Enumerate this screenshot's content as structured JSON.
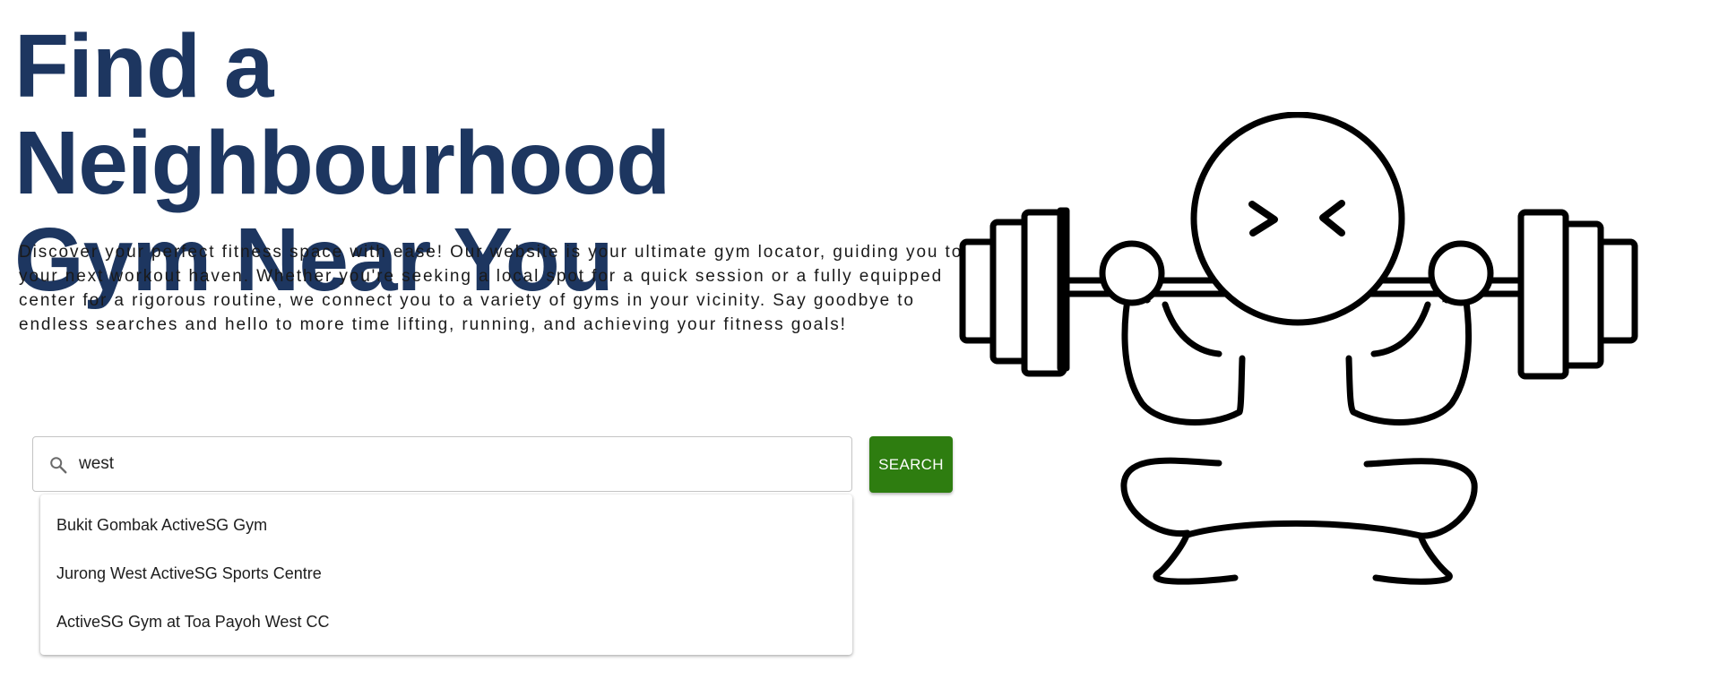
{
  "hero": {
    "title_line1": "Find a Neighbourhood",
    "title_line2": "Gym Near You",
    "description": "Discover your perfect fitness space with ease! Our website is your ultimate gym locator, guiding you to your next workout haven. Whether you're seeking a local spot for a quick session or a fully equipped center for a rigorous routine, we connect you to a variety of gyms in your vicinity. Say goodbye to endless searches and hello to more time lifting, running, and achieving your fitness goals!"
  },
  "search": {
    "icon": "search-icon",
    "value": "west",
    "button_label": "SEARCH"
  },
  "suggestions": [
    "Bukit Gombak ActiveSG Gym",
    "Jurong West ActiveSG Sports Centre",
    "ActiveSG Gym at Toa Payoh West CC"
  ],
  "illustration": {
    "icon": "weightlifter-illustration"
  },
  "colors": {
    "title": "#1d3660",
    "button": "#2e7d10",
    "line_art": "#000000"
  }
}
